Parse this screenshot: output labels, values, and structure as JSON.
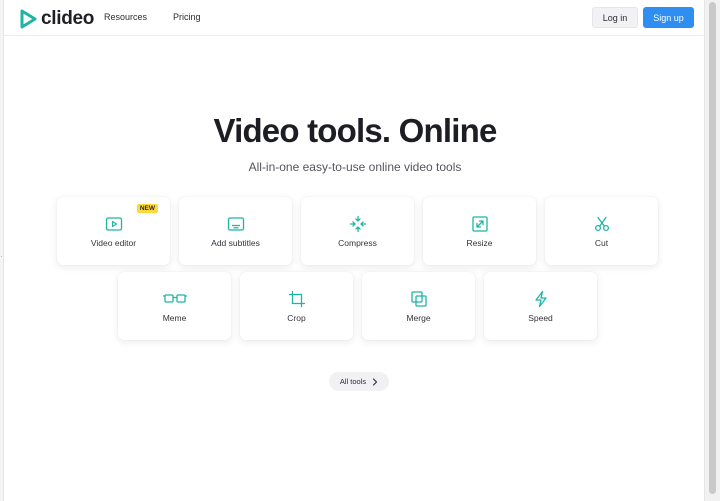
{
  "brand": {
    "name": "clideo",
    "accent": "#1fb5a5",
    "logo_icon": "play-logo-icon"
  },
  "nav": {
    "items": [
      {
        "label": "Resources"
      },
      {
        "label": "Pricing"
      }
    ]
  },
  "auth": {
    "login_label": "Log in",
    "signup_label": "Sign up",
    "signup_color": "#2f8ef2"
  },
  "hero": {
    "title": "Video tools. Online",
    "subtitle": "All-in-one easy-to-use online video tools"
  },
  "tools": {
    "row1": [
      {
        "label": "Video editor",
        "icon": "video-editor-icon",
        "badge": "NEW"
      },
      {
        "label": "Add subtitles",
        "icon": "subtitles-icon"
      },
      {
        "label": "Compress",
        "icon": "compress-icon"
      },
      {
        "label": "Resize",
        "icon": "resize-icon"
      },
      {
        "label": "Cut",
        "icon": "scissors-icon"
      }
    ],
    "row2": [
      {
        "label": "Meme",
        "icon": "meme-icon"
      },
      {
        "label": "Crop",
        "icon": "crop-icon"
      },
      {
        "label": "Merge",
        "icon": "merge-icon"
      },
      {
        "label": "Speed",
        "icon": "lightning-icon"
      }
    ],
    "icon_color": "#1fb5a5"
  },
  "all_tools": {
    "label": "All tools",
    "icon": "chevron-right-icon"
  }
}
